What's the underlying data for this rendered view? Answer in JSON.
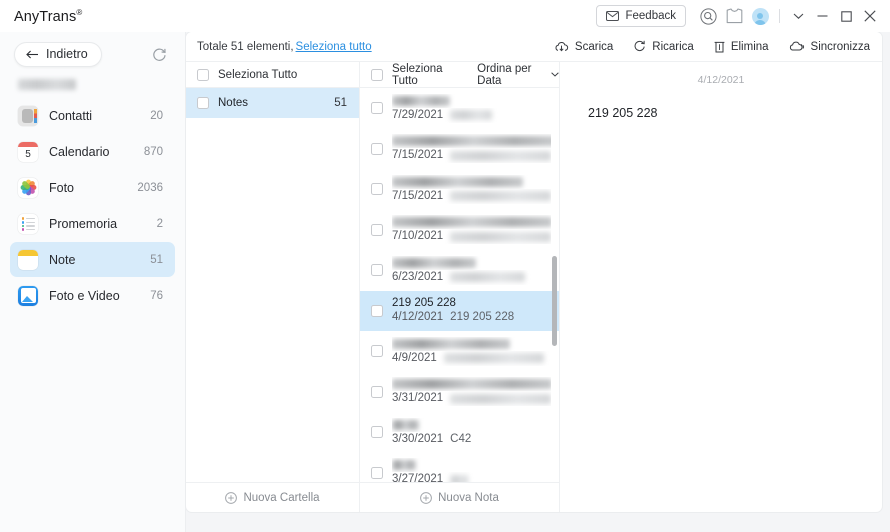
{
  "titlebar": {
    "brand": "AnyTrans",
    "brand_sup": "®",
    "feedback_label": "Feedback",
    "icons": {
      "search": "search-icon",
      "shirt": "shirt-icon",
      "avatar": "avatar-icon",
      "chevron": "chevron-down-icon",
      "minimize": "minimize-icon",
      "maximize": "maximize-icon",
      "close": "close-icon"
    }
  },
  "sidebar": {
    "back_label": "Indietro",
    "refresh_icon": "refresh-icon",
    "device_name": "",
    "items": [
      {
        "label": "Contatti",
        "count": "20",
        "icon": "contacts-icon",
        "active": false
      },
      {
        "label": "Calendario",
        "count": "870",
        "icon": "calendar-icon",
        "active": false,
        "day": "5"
      },
      {
        "label": "Foto",
        "count": "2036",
        "icon": "photos-icon",
        "active": false
      },
      {
        "label": "Promemoria",
        "count": "2",
        "icon": "reminders-icon",
        "active": false
      },
      {
        "label": "Note",
        "count": "51",
        "icon": "notes-icon",
        "active": true
      },
      {
        "label": "Foto e Video",
        "count": "76",
        "icon": "photos-video-icon",
        "active": false
      }
    ]
  },
  "toolbar": {
    "total_text": "Totale 51 elementi,",
    "select_all_link": "Seleziona tutto",
    "actions": [
      {
        "label": "Scarica",
        "icon": "download-cloud-icon"
      },
      {
        "label": "Ricarica",
        "icon": "refresh-icon"
      },
      {
        "label": "Elimina",
        "icon": "trash-icon"
      },
      {
        "label": "Sincronizza",
        "icon": "sync-cloud-icon"
      }
    ]
  },
  "folders": {
    "select_all_label": "Seleziona Tutto",
    "rows": [
      {
        "name": "Notes",
        "count": "51",
        "active": true
      }
    ],
    "new_folder_label": "Nuova Cartella"
  },
  "notes": {
    "select_all_label": "Seleziona Tutto",
    "sort_label": "Ordina per Data",
    "sort_caret": "▾",
    "new_note_label": "Nuova Nota",
    "rows": [
      {
        "title": "",
        "date": "7/29/2021",
        "preview": "",
        "redacted": true,
        "active": false,
        "title_w": 58,
        "prev_w": 42
      },
      {
        "title": "",
        "date": "7/15/2021",
        "preview": "",
        "redacted": true,
        "active": false,
        "title_w": 163,
        "prev_w": 108
      },
      {
        "title": "",
        "date": "7/15/2021",
        "preview": "",
        "redacted": true,
        "active": false,
        "title_w": 131,
        "prev_w": 112
      },
      {
        "title": "",
        "date": "7/10/2021",
        "preview": "",
        "redacted": true,
        "active": false,
        "title_w": 160,
        "prev_w": 112
      },
      {
        "title": "",
        "date": "6/23/2021",
        "preview": "",
        "redacted": true,
        "active": false,
        "title_w": 84,
        "prev_w": 75
      },
      {
        "title": "219 205 228",
        "date": "4/12/2021",
        "preview": "219 205 228",
        "redacted": false,
        "active": true,
        "title_w": 0,
        "prev_w": 0
      },
      {
        "title": "",
        "date": "4/9/2021",
        "preview": "",
        "redacted": true,
        "active": false,
        "title_w": 118,
        "prev_w": 100
      },
      {
        "title": "",
        "date": "3/31/2021",
        "preview": "",
        "redacted": true,
        "active": false,
        "title_w": 160,
        "prev_w": 110
      },
      {
        "title": "",
        "date": "3/30/2021",
        "preview": "C42",
        "redacted": true,
        "active": false,
        "title_w": 27,
        "prev_w": 0
      },
      {
        "title": "",
        "date": "3/27/2021",
        "preview": "",
        "redacted": true,
        "active": false,
        "title_w": 24,
        "prev_w": 18
      }
    ]
  },
  "detail": {
    "date": "4/12/2021",
    "body": "219 205 228"
  },
  "colors": {
    "accent": "#2b8fe0",
    "selection": "#cfe8fa",
    "sidebar_selection": "#d7ebfa",
    "background": "#f4f5f7",
    "notes_yellow": "#f5c633"
  }
}
